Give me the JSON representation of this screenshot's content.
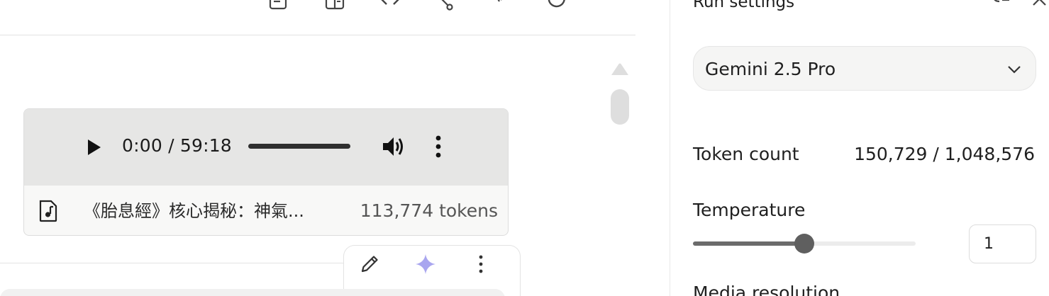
{
  "toolbar": {
    "icons": [
      "notes-icon",
      "compare-icon",
      "code-icon",
      "share-icon",
      "branch-icon",
      "refresh-icon",
      "more-vert-icon"
    ]
  },
  "audio": {
    "time": "0:00 / 59:18",
    "progress": 0,
    "file_name": "《胎息經》核心揭秘：神氣...",
    "file_tokens": "113,774 tokens",
    "file_icon": "audio-file-icon"
  },
  "actions": {
    "icons": [
      "edit-icon",
      "sparkle-icon",
      "more-vert-icon"
    ]
  },
  "settings": {
    "title": "Run settings",
    "model": {
      "selected": "Gemini 2.5 Pro"
    },
    "token_count": {
      "label": "Token count",
      "value": "150,729 / 1,048,576"
    },
    "temperature": {
      "label": "Temperature",
      "value": "1",
      "slider_fraction": 0.5
    },
    "media_resolution_label": "Media resolution"
  },
  "colors": {
    "player_bg": "#e6e6e5",
    "accent_sparkle": "#a9a6ef",
    "slider_thumb": "#5f5f5f"
  }
}
